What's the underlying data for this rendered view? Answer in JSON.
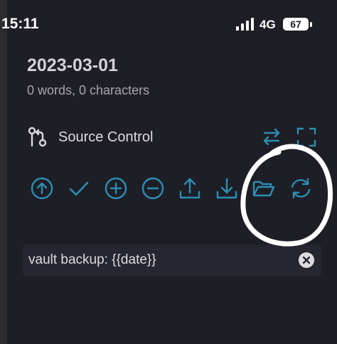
{
  "status_bar": {
    "time": "15:11",
    "network": "4G",
    "battery": "67"
  },
  "note": {
    "title": "2023-03-01",
    "stats": "0 words, 0 characters"
  },
  "source_control": {
    "label": "Source Control"
  },
  "toolbar": {
    "items": [
      {
        "icon": "push-icon"
      },
      {
        "icon": "commit-check-icon"
      },
      {
        "icon": "stage-all-icon"
      },
      {
        "icon": "unstage-all-icon"
      },
      {
        "icon": "upload-icon"
      },
      {
        "icon": "download-icon"
      },
      {
        "icon": "folder-open-icon"
      },
      {
        "icon": "refresh-icon"
      }
    ]
  },
  "commit": {
    "message": "vault backup: {{date}}"
  },
  "colors": {
    "accent": "#2a8fb4",
    "background": "#1e1e26",
    "field": "#262631"
  }
}
